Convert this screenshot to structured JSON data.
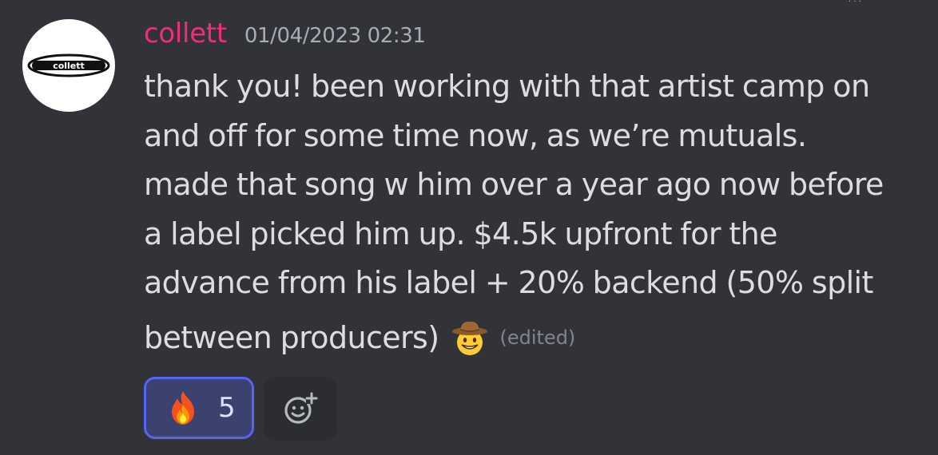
{
  "message": {
    "author": "collett",
    "avatar_text": "collett",
    "timestamp": "01/04/2023 02:31",
    "lines": [
      "thank you! been working with that artist camp on",
      "and off for some time now, as we’re mutuals.",
      "made that song w him over a year ago now before",
      "a label picked him up. $4.5k upfront for the",
      "advance from his label + 20% backend (50% split",
      "between producers)"
    ],
    "inline_emoji": "cowboy-hat-face",
    "edited_label": "(edited)"
  },
  "reactions": [
    {
      "emoji": "fire",
      "count": "5",
      "active": true
    }
  ],
  "add_reaction_icon": "add-reaction-icon",
  "colors": {
    "background": "#313338",
    "username": "#eb2f7c",
    "reaction_border": "#5865f2",
    "reaction_bg": "#3c4270"
  }
}
